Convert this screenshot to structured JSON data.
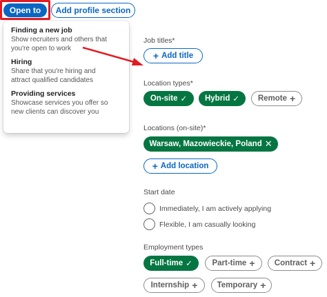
{
  "top_bar": {
    "open_to_label": "Open to",
    "add_profile_label": "Add profile section"
  },
  "dropdown": {
    "items": [
      {
        "title": "Finding a new job",
        "desc_line1": "Show recruiters and others that",
        "desc_line2": "you're open to work"
      },
      {
        "title": "Hiring",
        "desc_line1": "Share that you're hiring and",
        "desc_line2": "attract qualified candidates"
      },
      {
        "title": "Providing services",
        "desc_line1": "Showcase services you offer so",
        "desc_line2": "new clients can discover you"
      }
    ]
  },
  "form": {
    "job_titles": {
      "label": "Job titles*",
      "add_label": "Add title"
    },
    "location_types": {
      "label": "Location types*",
      "options": [
        {
          "label": "On-site",
          "selected": true
        },
        {
          "label": "Hybrid",
          "selected": true
        },
        {
          "label": "Remote",
          "selected": false
        }
      ]
    },
    "locations": {
      "label": "Locations (on-site)*",
      "selected": "Warsaw, Mazowieckie, Poland",
      "add_label": "Add location"
    },
    "start_date": {
      "label": "Start date",
      "options": [
        "Immediately, I am actively applying",
        "Flexible, I am casually looking"
      ]
    },
    "employment_types": {
      "label": "Employment types",
      "options": [
        {
          "label": "Full-time",
          "selected": true
        },
        {
          "label": "Part-time",
          "selected": false
        },
        {
          "label": "Contract",
          "selected": false
        },
        {
          "label": "Internship",
          "selected": false
        },
        {
          "label": "Temporary",
          "selected": false
        }
      ]
    }
  },
  "icons": {
    "check": "check-icon",
    "plus": "plus-icon",
    "remove": "close-icon",
    "arrow": "arrow-icon"
  },
  "colors": {
    "brand_blue": "#0a66c2",
    "selected_green": "#057642",
    "highlight_red": "#e11b22"
  }
}
